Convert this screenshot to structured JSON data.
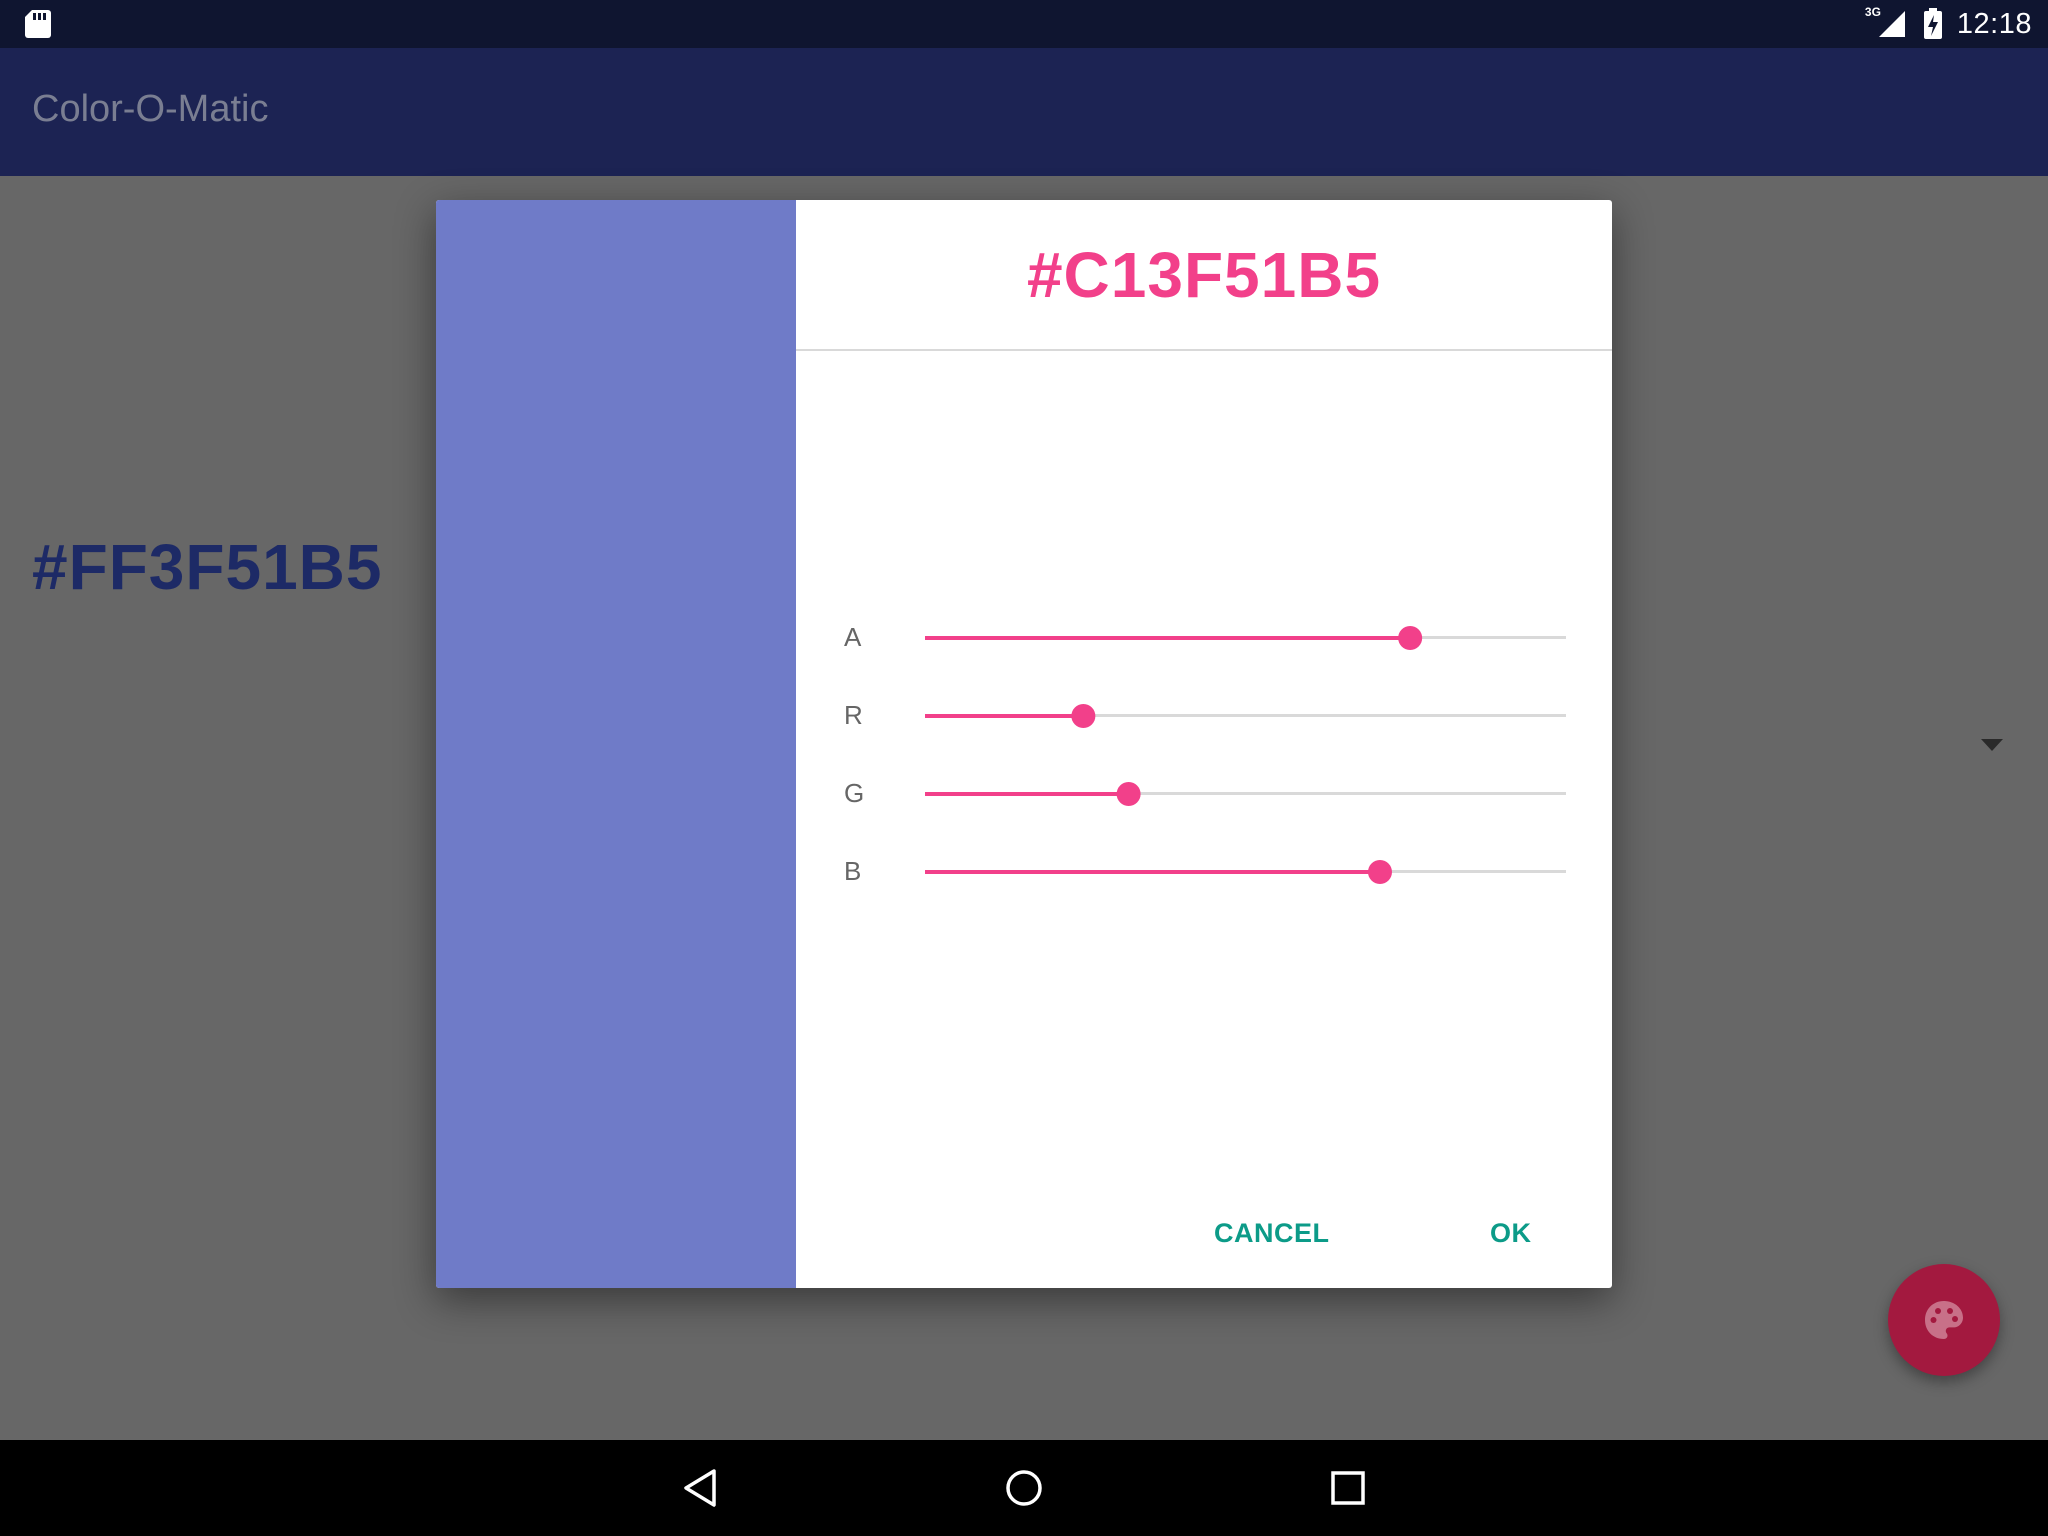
{
  "status_bar": {
    "network": "3G",
    "time": "12:18"
  },
  "app": {
    "title": "Color-O-Matic"
  },
  "main": {
    "current_color": "#FF3F51B5"
  },
  "dialog": {
    "title": "#C13F51B5",
    "swatch_color": "#6f7bc8",
    "sliders": [
      {
        "label": "A",
        "value": 193,
        "max": 255
      },
      {
        "label": "R",
        "value": 63,
        "max": 255
      },
      {
        "label": "G",
        "value": 81,
        "max": 255
      },
      {
        "label": "B",
        "value": 181,
        "max": 255
      }
    ],
    "cancel_label": "CANCEL",
    "ok_label": "OK"
  },
  "colors": {
    "accent": "#f2408a",
    "primary_dark": "#1c2353",
    "button_text": "#0c9b88",
    "fab": "#a3193f"
  },
  "icons": {
    "sd_card": "sd-card-icon",
    "signal": "signal-icon",
    "battery": "battery-charging-icon",
    "dropdown": "dropdown-arrow-icon",
    "fab": "palette-icon",
    "nav_back": "back-icon",
    "nav_home": "home-icon",
    "nav_recents": "recents-icon"
  }
}
